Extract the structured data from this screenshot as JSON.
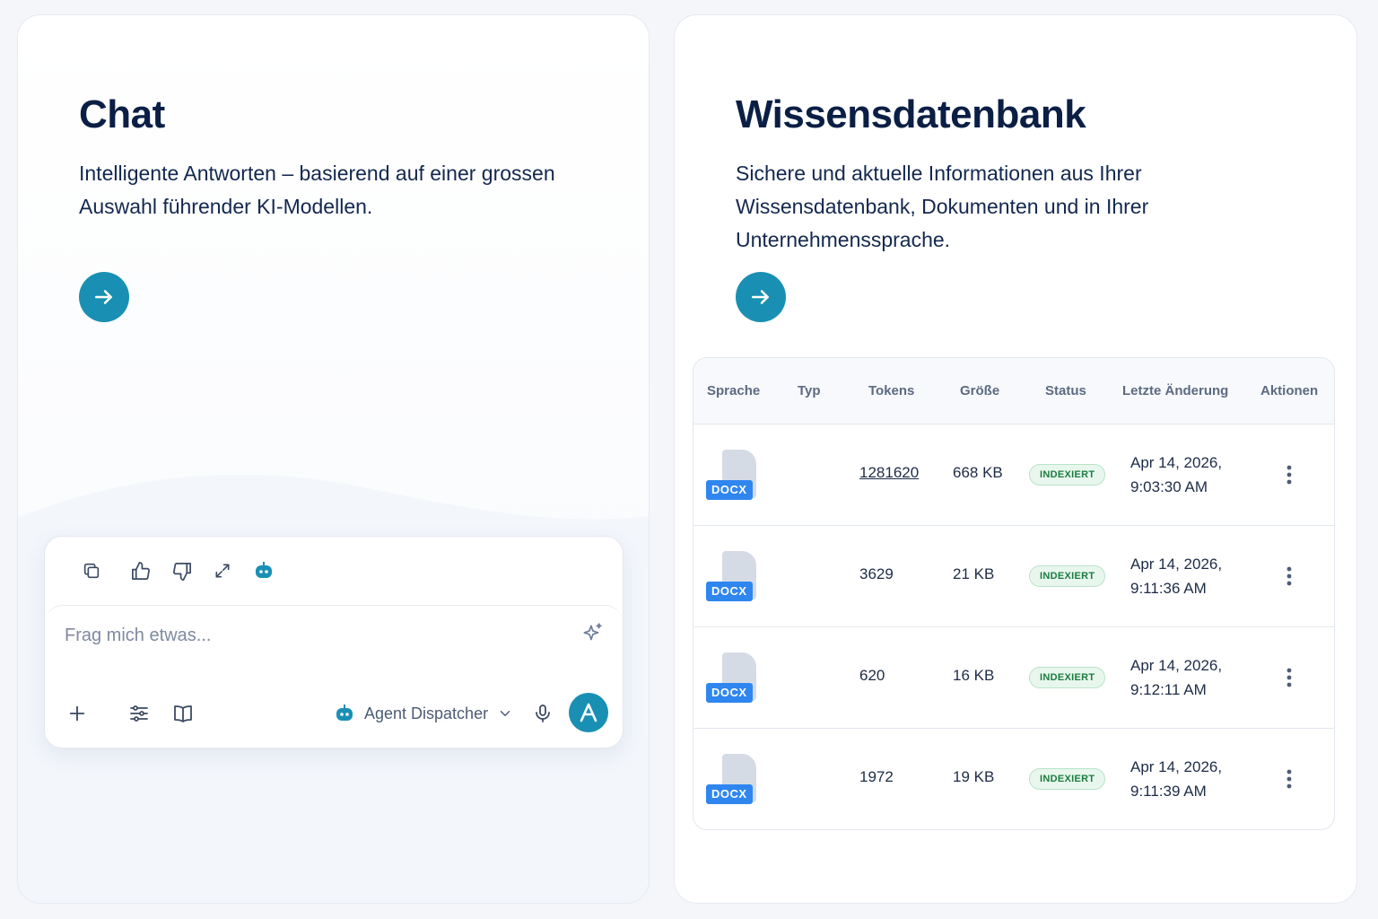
{
  "chat": {
    "title": "Chat",
    "description": "Intelligente Antworten – basierend auf einer grossen Auswahl führender KI-Modellen.",
    "go_icon": "arrow-right-icon",
    "composer": {
      "placeholder": "Frag mich etwas...",
      "tools": [
        "copy-icon",
        "thumbs-up-icon",
        "thumbs-down-icon",
        "expand-icon",
        "robot-icon"
      ],
      "bottom_tools": [
        "plus-icon",
        "sliders-icon",
        "book-icon"
      ],
      "agent_label": "Agent Dispatcher",
      "send_icon": "brand-a-icon"
    }
  },
  "kb": {
    "title": "Wissensdatenbank",
    "description": "Sichere und aktuelle Informationen aus Ihrer Wissensdatenbank, Dokumenten und in Ihrer Unternehmenssprache.",
    "go_icon": "arrow-right-icon",
    "table": {
      "headers": [
        "Sprache",
        "Typ",
        "Tokens",
        "Größe",
        "Status",
        "Letzte Änderung",
        "Aktionen"
      ],
      "rows": [
        {
          "type": "DOCX",
          "tokens": "1281620",
          "size": "668 KB",
          "status": "INDEXIERT",
          "date_line1": "Apr 14, 2026,",
          "date_line2": "9:03:30 AM"
        },
        {
          "type": "DOCX",
          "tokens": "3629",
          "size": "21 KB",
          "status": "INDEXIERT",
          "date_line1": "Apr 14, 2026,",
          "date_line2": "9:11:36 AM"
        },
        {
          "type": "DOCX",
          "tokens": "620",
          "size": "16 KB",
          "status": "INDEXIERT",
          "date_line1": "Apr 14, 2026,",
          "date_line2": "9:12:11 AM"
        },
        {
          "type": "DOCX",
          "tokens": "1972",
          "size": "19 KB",
          "status": "INDEXIERT",
          "date_line1": "Apr 14, 2026,",
          "date_line2": "9:11:39 AM"
        }
      ]
    }
  },
  "colors": {
    "accent": "#1990b3",
    "title": "#0b1f45",
    "docx_badge": "#2f86ef",
    "status_green": "#1b7c3f"
  }
}
